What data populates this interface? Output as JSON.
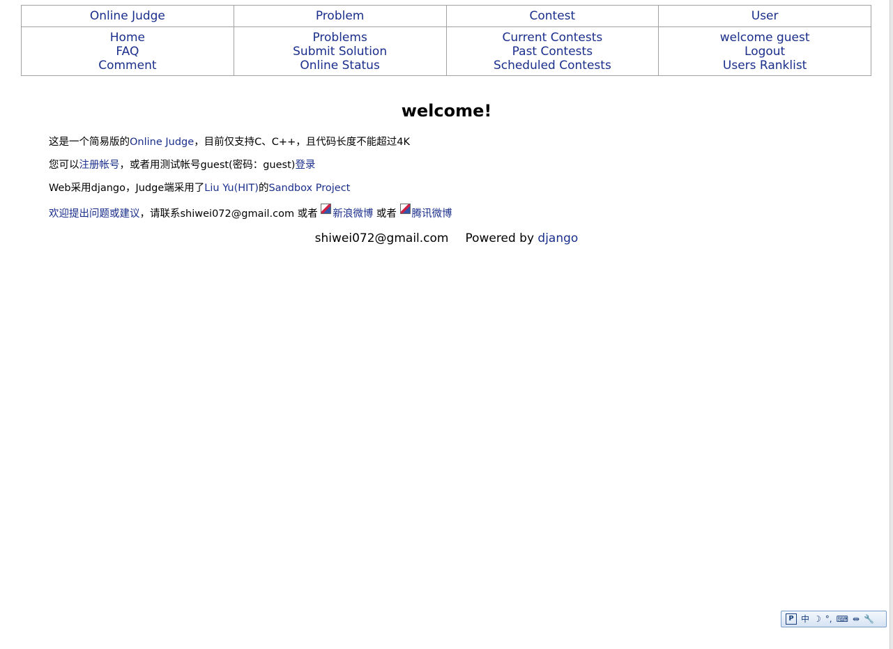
{
  "nav": {
    "headers": [
      "Online Judge",
      "Problem",
      "Contest",
      "User"
    ],
    "columns": [
      [
        "Home",
        "FAQ",
        "Comment"
      ],
      [
        "Problems",
        "Submit Solution",
        "Online Status"
      ],
      [
        "Current Contests",
        "Past Contests",
        "Scheduled Contests"
      ],
      [
        "welcome guest",
        "Logout",
        "Users Ranklist"
      ]
    ]
  },
  "main": {
    "title": "welcome!",
    "line1": {
      "prefix": "这是一个简易版的",
      "link": "Online Judge",
      "suffix": "，目前仅支持C、C++，且代码长度不能超过4K"
    },
    "line2": {
      "prefix": "您可以",
      "register_link": "注册帐号",
      "middle": "，或者用测试帐号guest(密码：guest)",
      "login_link": "登录"
    },
    "line3": {
      "prefix": "Web采用django，Judge端采用了",
      "author_link": "Liu Yu(HIT)",
      "middle": "的",
      "project_link": "Sandbox Project"
    },
    "line4": {
      "feedback_link": "欢迎提出问题或建议",
      "contact": "，请联系shiwei072@gmail.com 或者 ",
      "sina_link": "新浪微博",
      "or": " 或者 ",
      "tencent_link": "腾讯微博"
    }
  },
  "footer": {
    "email": "shiwei072@gmail.com",
    "powered_by": "Powered by",
    "django_link": "django"
  },
  "ime_toolbar": {
    "mode": "中",
    "icons": [
      "moon-icon",
      "punctuation-icon",
      "keyboard-icon",
      "split-icon",
      "wrench-icon"
    ]
  }
}
